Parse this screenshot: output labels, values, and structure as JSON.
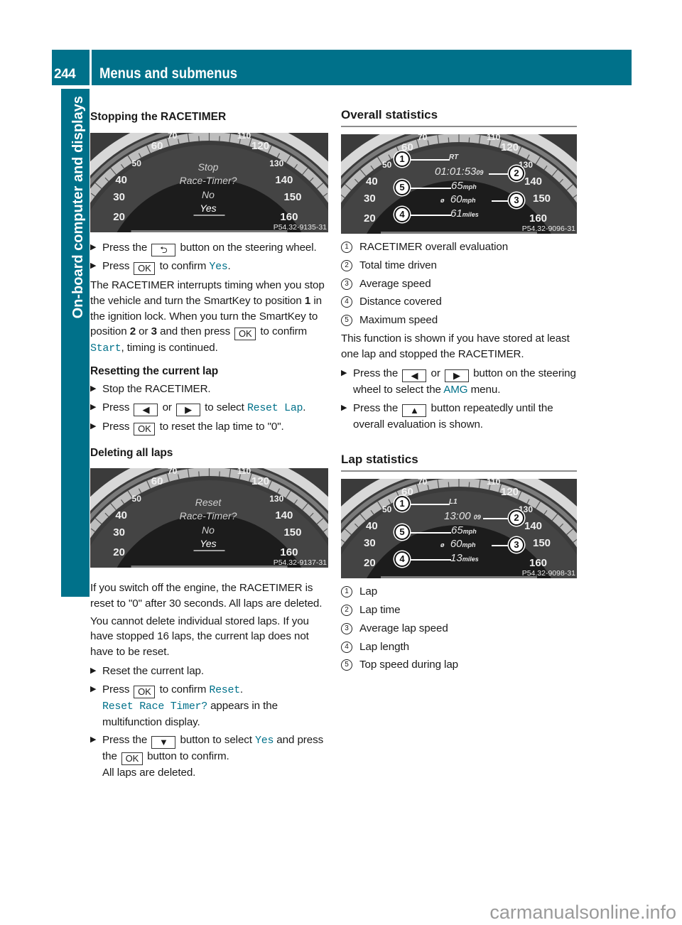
{
  "header": {
    "page_number": "244",
    "title": "Menus and submenus"
  },
  "side_tab": "On-board computer and displays",
  "left": {
    "section1_title": "Stopping the RACETIMER",
    "figure1": {
      "line1": "Stop",
      "line2": "Race-Timer?",
      "option_no": "No",
      "option_yes": "Yes",
      "code": "P54.32-9135-31"
    },
    "step1a": "Press the",
    "step1b": "button on the steering wheel.",
    "step2a": "Press",
    "step2b": "to confirm",
    "step2_value": "Yes",
    "para1_a": "The RACETIMER interrupts timing when you stop the vehicle and turn the SmartKey to position",
    "para1_pos1": "1",
    "para1_b": "in the ignition lock. When you turn the SmartKey to position",
    "para1_pos2": "2",
    "para1_or": "or",
    "para1_pos3": "3",
    "para1_c": "and then press",
    "para1_d": "to confirm",
    "para1_value": "Start",
    "para1_e": ", timing is continued.",
    "section2_title": "Resetting the current lap",
    "s2_step1": "Stop the RACETIMER.",
    "s2_step2a": "Press",
    "s2_step2_or": "or",
    "s2_step2b": "to select",
    "s2_step2_value": "Reset Lap",
    "s2_step3a": "Press",
    "s2_step3b": "to reset the lap time to \"0\".",
    "section3_title": "Deleting all laps",
    "figure2": {
      "line1": "Reset",
      "line2": "Race-Timer?",
      "option_no": "No",
      "option_yes": "Yes",
      "code": "P54.32-9137-31"
    },
    "para2": "If you switch off the engine, the RACETIMER is reset to \"0\" after 30 seconds. All laps are deleted.",
    "para3": "You cannot delete individual stored laps. If you have stopped 16 laps, the current lap does not have to be reset.",
    "s3_step1": "Reset the current lap.",
    "s3_step2a": "Press",
    "s3_step2b": "to confirm",
    "s3_step2_value": "Reset",
    "s3_step2_msg": "Reset Race Timer?",
    "s3_step2c": "appears in the multifunction display.",
    "s3_step3a": "Press the",
    "s3_step3b": "button to select",
    "s3_step3_value": "Yes",
    "s3_step3c": "and press the",
    "s3_step3d": "button to confirm.",
    "s3_step3e": "All laps are deleted."
  },
  "right": {
    "section1_title": "Overall statistics",
    "figure3": {
      "label": "RT",
      "time": "01:01:53",
      "time_hundredths": "09",
      "max_speed": "65",
      "avg_symbol": "ø",
      "avg_speed": "60",
      "speed_unit": "mph",
      "distance": "61",
      "distance_unit": "miles",
      "code": "P54.32-9096-31"
    },
    "legend1": [
      {
        "num": "1",
        "text": "RACETIMER overall evaluation"
      },
      {
        "num": "2",
        "text": "Total time driven"
      },
      {
        "num": "3",
        "text": "Average speed"
      },
      {
        "num": "4",
        "text": "Distance covered"
      },
      {
        "num": "5",
        "text": "Maximum speed"
      }
    ],
    "para1": "This function is shown if you have stored at least one lap and stopped the RACETIMER.",
    "step1a": "Press the",
    "step1_or": "or",
    "step1b": "button on the steering wheel to select the",
    "step1_value": "AMG",
    "step1c": "menu.",
    "step2a": "Press the",
    "step2b": "button repeatedly until the overall evaluation is shown.",
    "section2_title": "Lap statistics",
    "figure4": {
      "label": "L1",
      "time": "13:00",
      "time_hundredths": "09",
      "max_speed": "65",
      "avg_symbol": "ø",
      "avg_speed": "60",
      "speed_unit": "mph",
      "distance": "13",
      "distance_unit": "miles",
      "code": "P54.32-9098-31"
    },
    "legend2": [
      {
        "num": "1",
        "text": "Lap"
      },
      {
        "num": "2",
        "text": "Lap time"
      },
      {
        "num": "3",
        "text": "Average lap speed"
      },
      {
        "num": "4",
        "text": "Lap length"
      },
      {
        "num": "5",
        "text": "Top speed during lap"
      }
    ]
  },
  "keys": {
    "back": "⮌",
    "ok": "OK",
    "left": "◀",
    "right": "▶",
    "down": "▼",
    "up": "▲",
    "bullet": "▶"
  },
  "gauge": {
    "left_ticks": [
      "20",
      "30",
      "40",
      "50",
      "60",
      "70"
    ],
    "right_ticks": [
      "110",
      "120",
      "130",
      "140",
      "150",
      "160"
    ]
  },
  "watermark": "carmanualsonline.info"
}
